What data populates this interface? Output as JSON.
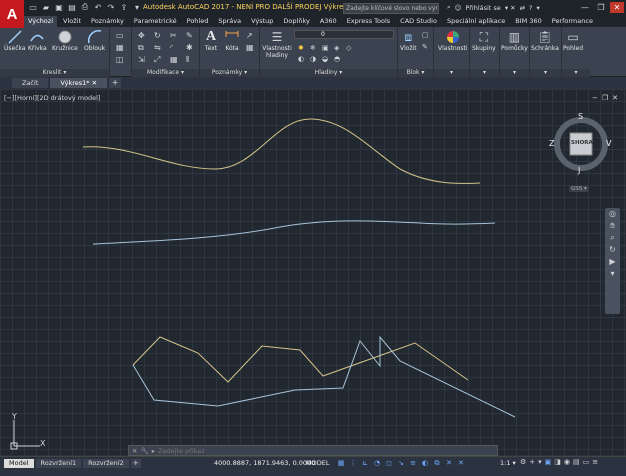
{
  "title_bar": {
    "logo": "A",
    "title": "Autodesk AutoCAD 2017 - NENÍ PRO DALŠÍ PRODEJ   Výkres1.dwg",
    "search_placeholder": "Zadejte klíčové slovo nebo výraz",
    "sign_in": "Přihlásit se",
    "help": "?"
  },
  "ribbon_tabs": [
    "Výchozí",
    "Vložit",
    "Poznámky",
    "Parametrické",
    "Pohled",
    "Správa",
    "Výstup",
    "Doplňky",
    "A360",
    "Express Tools",
    "CAD Studio",
    "Speciální aplikace",
    "BIM 360",
    "Performance"
  ],
  "ribbon": {
    "kreslit": {
      "title": "Kreslit ▾",
      "usecka": "Úsečka",
      "krivka": "Křivka",
      "kruznice": "Kružnice",
      "oblouk": "Oblouk"
    },
    "modifikace": {
      "title": "Modifikace ▾"
    },
    "poznamky": {
      "title": "Poznámky ▾",
      "text": "Text",
      "kota": "Kóta"
    },
    "hladiny": {
      "title": "Hladiny ▾",
      "vlastnosti_hladiny": "Vlastnosti hladiny",
      "layer_value": "0"
    },
    "blok": {
      "title": "Blok ▾",
      "vlozit": "Vložit"
    },
    "vlastnosti": {
      "label": "Vlastnosti"
    },
    "skupiny": {
      "label": "Skupiny"
    },
    "pomucky": {
      "label": "Pomůcky"
    },
    "schranka": {
      "label": "Schránka"
    },
    "pohled": {
      "label": "Pohled"
    }
  },
  "file_tabs": [
    "Začít",
    "Výkres1*"
  ],
  "viewport": {
    "label": "[−][Horní][2D drátový model]",
    "viewcube": {
      "top": "S",
      "bottom": "J",
      "left": "Z",
      "right": "V",
      "face": "SHORA",
      "wcs": "GSS ▾"
    }
  },
  "ucs": {
    "x": "X",
    "y": "Y"
  },
  "command_line": {
    "placeholder": "Zadejte příkaz"
  },
  "status_bar": {
    "layout_tabs": [
      "Model",
      "Rozvržení1",
      "Rozvržení2"
    ],
    "coordinates": "4000.8887, 1871.9463, 0.0000",
    "model": "MODEL",
    "scale": "1:1 ▾"
  },
  "colors": {
    "canvas": "#212830",
    "yellow_line": "#d4c48a",
    "blue_line": "#a9c4d8",
    "accent": "#c41a1f"
  }
}
